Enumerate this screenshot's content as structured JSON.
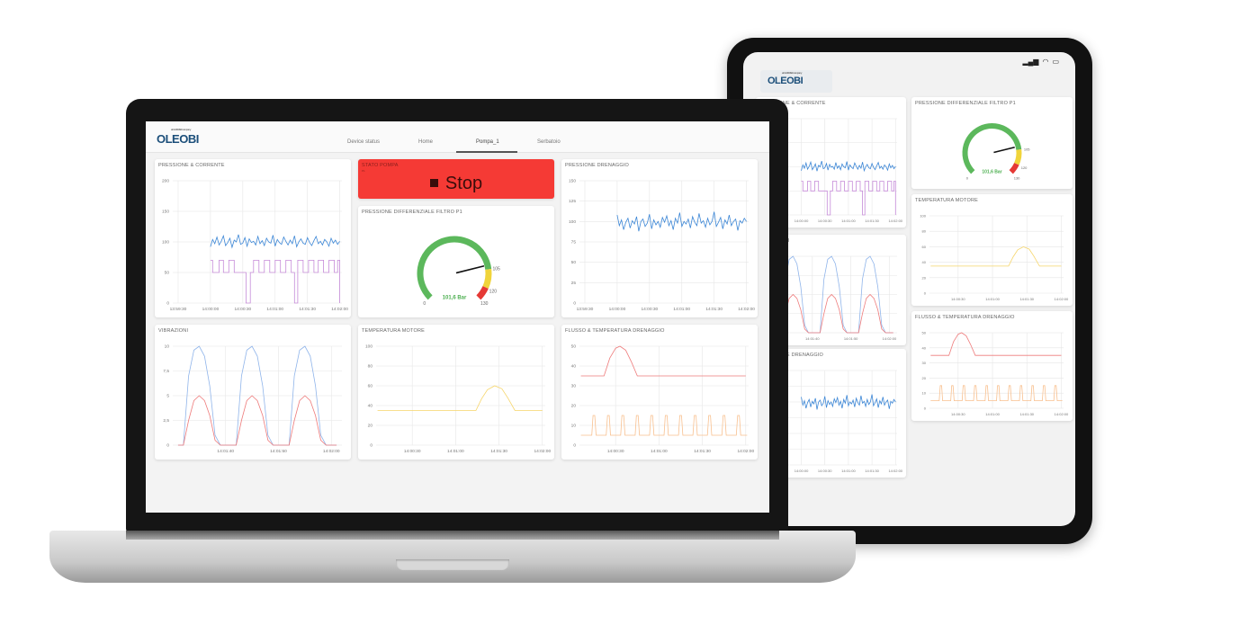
{
  "brand": {
    "logo_text": "OLEOBI",
    "logo_tagline": "a FLUIDMEC company"
  },
  "tabs": [
    {
      "label": "Device status",
      "active": false
    },
    {
      "label": "Home",
      "active": false
    },
    {
      "label": "Pompa_1",
      "active": true
    },
    {
      "label": "Serbatoio",
      "active": false
    }
  ],
  "status_bar": {
    "icons": [
      "signal-icon",
      "wifi-icon",
      "battery-icon"
    ]
  },
  "stato_pompa": {
    "title": "STATO POMPA",
    "subtitle": "P1",
    "state": "Stop",
    "color": "#f53a35",
    "icon": "stop-square-icon"
  },
  "gauge": {
    "title": "PRESSIONE DIFFERENZIALE FILTRO P1",
    "min": 0,
    "max": 130,
    "value": 101.6,
    "value_label": "101,6 Bar",
    "labels": [
      "0",
      "105",
      "120",
      "130"
    ],
    "segments": [
      {
        "from": 0,
        "to": 105,
        "color": "#5cb85c"
      },
      {
        "from": 105,
        "to": 120,
        "color": "#f0d43a"
      },
      {
        "from": 120,
        "to": 130,
        "color": "#e53935"
      }
    ]
  },
  "chart_data": [
    {
      "id": "pressione_corrente",
      "type": "line",
      "title": "PRESSIONE & CORRENTE",
      "xlim": [
        "13:59:25",
        "14:02:02"
      ],
      "ylim": [
        0,
        200
      ],
      "xticks": [
        "13:59:30",
        "14:00:00",
        "14:00:30",
        "14:01:00",
        "14:01:30",
        "14:02:00"
      ],
      "yticks": [
        0,
        50,
        100,
        150,
        200
      ],
      "ytick_labels": [
        "0",
        "50",
        "100",
        "150",
        "200"
      ],
      "grid": true,
      "series": [
        {
          "color": "#3b86d6",
          "x_start": "14:00:00",
          "x_step_s": 2,
          "values": [
            92,
            104,
            97,
            108,
            95,
            101,
            110,
            94,
            99,
            106,
            91,
            103,
            100,
            112,
            96,
            98,
            107,
            93,
            105,
            99,
            101,
            95,
            109,
            97,
            102,
            94,
            106,
            100,
            98,
            111,
            93,
            104,
            99,
            96,
            108,
            101,
            95,
            103,
            97,
            110,
            92,
            100,
            105,
            98,
            96,
            107,
            99,
            94,
            102,
            109,
            97,
            101,
            95,
            104,
            100,
            93,
            106,
            98,
            103,
            96,
            101
          ]
        },
        {
          "color": "#c58ad8",
          "step": true,
          "points": [
            [
              "14:00:00",
              70
            ],
            [
              "14:00:02",
              50
            ],
            [
              "14:00:08",
              70
            ],
            [
              "14:00:12",
              50
            ],
            [
              "14:00:17",
              70
            ],
            [
              "14:00:22",
              50
            ],
            [
              "14:00:30",
              50
            ],
            [
              "14:00:33",
              0
            ],
            [
              "14:00:37",
              0
            ],
            [
              "14:00:37",
              50
            ],
            [
              "14:00:40",
              70
            ],
            [
              "14:00:45",
              50
            ],
            [
              "14:00:50",
              70
            ],
            [
              "14:00:55",
              50
            ],
            [
              "14:01:00",
              70
            ],
            [
              "14:01:05",
              50
            ],
            [
              "14:01:10",
              70
            ],
            [
              "14:01:15",
              50
            ],
            [
              "14:01:18",
              0
            ],
            [
              "14:01:21",
              0
            ],
            [
              "14:01:21",
              70
            ],
            [
              "14:01:26",
              50
            ],
            [
              "14:01:31",
              70
            ],
            [
              "14:01:36",
              50
            ],
            [
              "14:01:40",
              70
            ],
            [
              "14:01:45",
              50
            ],
            [
              "14:01:50",
              70
            ],
            [
              "14:01:55",
              50
            ],
            [
              "14:01:58",
              70
            ],
            [
              "14:02:00",
              70
            ],
            [
              "14:02:00",
              0
            ]
          ]
        }
      ]
    },
    {
      "id": "pressione_drenaggio",
      "type": "line",
      "title": "PRESSIONE DRENAGGIO",
      "xlim": [
        "13:59:25",
        "14:02:02"
      ],
      "ylim": [
        0,
        150
      ],
      "xticks": [
        "13:59:30",
        "14:00:00",
        "14:00:30",
        "14:01:00",
        "14:01:30",
        "14:02:00"
      ],
      "yticks": [
        0,
        25,
        50,
        75,
        100,
        125,
        150
      ],
      "ytick_labels": [
        "0",
        "25",
        "50",
        "75",
        "100",
        "125",
        "150"
      ],
      "grid": true,
      "series": [
        {
          "color": "#3b86d6",
          "x_start": "14:00:00",
          "x_step_s": 2,
          "values": [
            108,
            95,
            102,
            90,
            99,
            104,
            92,
            101,
            97,
            106,
            88,
            100,
            103,
            94,
            98,
            109,
            91,
            102,
            96,
            100,
            93,
            105,
            99,
            107,
            95,
            101,
            90,
            104,
            98,
            111,
            94,
            100,
            97,
            103,
            92,
            106,
            99,
            95,
            110,
            98,
            101,
            93,
            104,
            96,
            100,
            112,
            94,
            99,
            105,
            91,
            102,
            97,
            108,
            95,
            100,
            103,
            89,
            101,
            98,
            104,
            100
          ]
        }
      ]
    },
    {
      "id": "vibrazioni",
      "type": "line",
      "title": "VIBRAZIONI",
      "xlim": [
        "14:01:30",
        "14:02:02"
      ],
      "ylim": [
        0,
        10
      ],
      "xticks": [
        "14:01:40",
        "14:01:50",
        "14:02:00"
      ],
      "yticks": [
        0,
        2.5,
        5,
        7.5,
        10
      ],
      "ytick_labels": [
        "0",
        "2,5",
        "5",
        "7,5",
        "10"
      ],
      "grid": true,
      "series": [
        {
          "color": "#8fb4ea",
          "points": [
            [
              "14:01:31",
              0
            ],
            [
              "14:01:32",
              0
            ],
            [
              "14:01:33",
              7
            ],
            [
              "14:01:34",
              9.6
            ],
            [
              "14:01:35",
              10
            ],
            [
              "14:01:36",
              9
            ],
            [
              "14:01:37",
              6
            ],
            [
              "14:01:38",
              1
            ],
            [
              "14:01:39",
              0
            ],
            [
              "14:01:41",
              0
            ],
            [
              "14:01:42",
              0
            ],
            [
              "14:01:43",
              7
            ],
            [
              "14:01:44",
              9.6
            ],
            [
              "14:01:45",
              10
            ],
            [
              "14:01:46",
              9
            ],
            [
              "14:01:47",
              6
            ],
            [
              "14:01:48",
              1
            ],
            [
              "14:01:49",
              0
            ],
            [
              "14:01:51",
              0
            ],
            [
              "14:01:52",
              0
            ],
            [
              "14:01:53",
              7
            ],
            [
              "14:01:54",
              9.6
            ],
            [
              "14:01:55",
              10
            ],
            [
              "14:01:56",
              9
            ],
            [
              "14:01:57",
              6
            ],
            [
              "14:01:58",
              1
            ],
            [
              "14:01:59",
              0
            ],
            [
              "14:02:01",
              0
            ]
          ]
        },
        {
          "color": "#ee7b7b",
          "points": [
            [
              "14:01:31",
              0
            ],
            [
              "14:01:32",
              0
            ],
            [
              "14:01:33",
              2.5
            ],
            [
              "14:01:34",
              4.5
            ],
            [
              "14:01:35",
              5
            ],
            [
              "14:01:36",
              4.5
            ],
            [
              "14:01:37",
              3
            ],
            [
              "14:01:38",
              0.5
            ],
            [
              "14:01:39",
              0
            ],
            [
              "14:01:41",
              0
            ],
            [
              "14:01:42",
              0
            ],
            [
              "14:01:43",
              2.5
            ],
            [
              "14:01:44",
              4.5
            ],
            [
              "14:01:45",
              5
            ],
            [
              "14:01:46",
              4.5
            ],
            [
              "14:01:47",
              3
            ],
            [
              "14:01:48",
              0.5
            ],
            [
              "14:01:49",
              0
            ],
            [
              "14:01:51",
              0
            ],
            [
              "14:01:52",
              0
            ],
            [
              "14:01:53",
              2.5
            ],
            [
              "14:01:54",
              4.5
            ],
            [
              "14:01:55",
              5
            ],
            [
              "14:01:56",
              4.5
            ],
            [
              "14:01:57",
              3
            ],
            [
              "14:01:58",
              0.5
            ],
            [
              "14:01:59",
              0
            ],
            [
              "14:02:01",
              0
            ]
          ]
        }
      ]
    },
    {
      "id": "temperatura_motore",
      "type": "line",
      "title": "TEMPERATURA MOTORE",
      "xlim": [
        "14:00:05",
        "14:02:02"
      ],
      "ylim": [
        0,
        100
      ],
      "xticks": [
        "14:00:30",
        "14:01:00",
        "14:01:30",
        "14:02:00"
      ],
      "yticks": [
        0,
        20,
        40,
        60,
        80,
        100
      ],
      "ytick_labels": [
        "0",
        "20",
        "40",
        "60",
        "80",
        "100"
      ],
      "grid": true,
      "series": [
        {
          "color": "#f6d56a",
          "points": [
            [
              "14:00:06",
              35
            ],
            [
              "14:01:14",
              35
            ],
            [
              "14:01:18",
              47
            ],
            [
              "14:01:22",
              56
            ],
            [
              "14:01:27",
              60
            ],
            [
              "14:01:32",
              57
            ],
            [
              "14:01:36",
              48
            ],
            [
              "14:01:41",
              35
            ],
            [
              "14:02:00",
              35
            ]
          ]
        }
      ]
    },
    {
      "id": "flusso_temperatura_drenaggio",
      "type": "line",
      "title": "FLUSSO & TEMPERATURA DRENAGGIO",
      "xlim": [
        "14:00:05",
        "14:02:02"
      ],
      "ylim": [
        0,
        50
      ],
      "xticks": [
        "14:00:30",
        "14:01:00",
        "14:01:30",
        "14:02:00"
      ],
      "yticks": [
        0,
        10,
        20,
        30,
        40,
        50
      ],
      "ytick_labels": [
        "0",
        "10",
        "20",
        "30",
        "40",
        "50"
      ],
      "grid": true,
      "series": [
        {
          "color": "#ee7b7b",
          "points": [
            [
              "14:00:06",
              35
            ],
            [
              "14:00:22",
              35
            ],
            [
              "14:00:26",
              44
            ],
            [
              "14:00:30",
              49
            ],
            [
              "14:00:33",
              50
            ],
            [
              "14:00:37",
              48
            ],
            [
              "14:00:41",
              42
            ],
            [
              "14:00:45",
              35
            ],
            [
              "14:02:00",
              35
            ]
          ]
        },
        {
          "color": "#f8c08f",
          "pulse": {
            "start": "14:00:15",
            "period_s": 10,
            "count": 11,
            "low": 5,
            "high": 15
          }
        }
      ]
    }
  ]
}
